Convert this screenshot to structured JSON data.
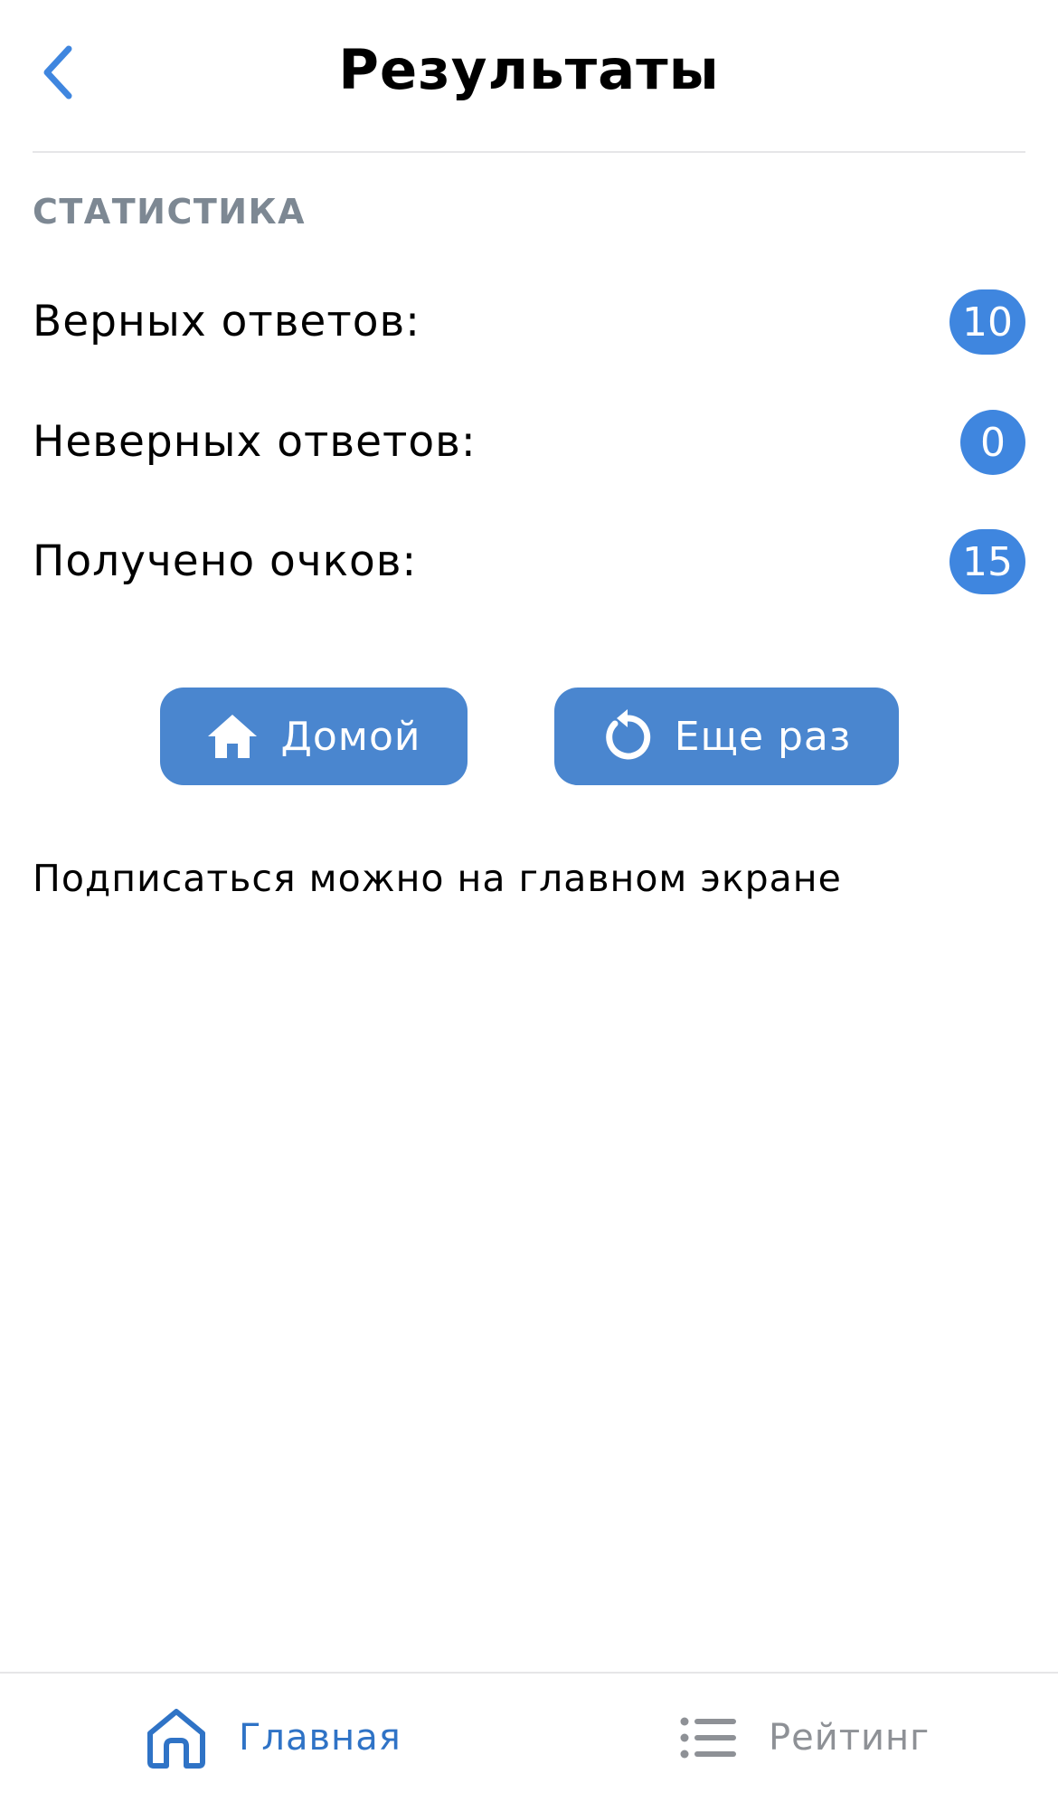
{
  "header": {
    "title": "Результаты",
    "back_icon": "chevron-left-icon"
  },
  "statistics": {
    "section_title": "СТАТИСТИКА",
    "rows": [
      {
        "label": "Верных ответов:",
        "value": "10"
      },
      {
        "label": "Неверных ответов:",
        "value": "0"
      },
      {
        "label": "Получено очков:",
        "value": "15"
      }
    ]
  },
  "actions": {
    "home_label": "Домой",
    "home_icon": "home-icon",
    "retry_label": "Еще раз",
    "retry_icon": "retry-icon"
  },
  "hint": "Подписаться можно на главном экране",
  "tabbar": {
    "home_label": "Главная",
    "home_icon": "home-outline-icon",
    "rating_label": "Рейтинг",
    "rating_icon": "list-icon",
    "active": "home"
  },
  "colors": {
    "accent": "#3f86df",
    "button": "#4a86cf",
    "section_title": "#7d8893",
    "tab_active": "#2f73c6",
    "tab_inactive": "#8e9196"
  }
}
